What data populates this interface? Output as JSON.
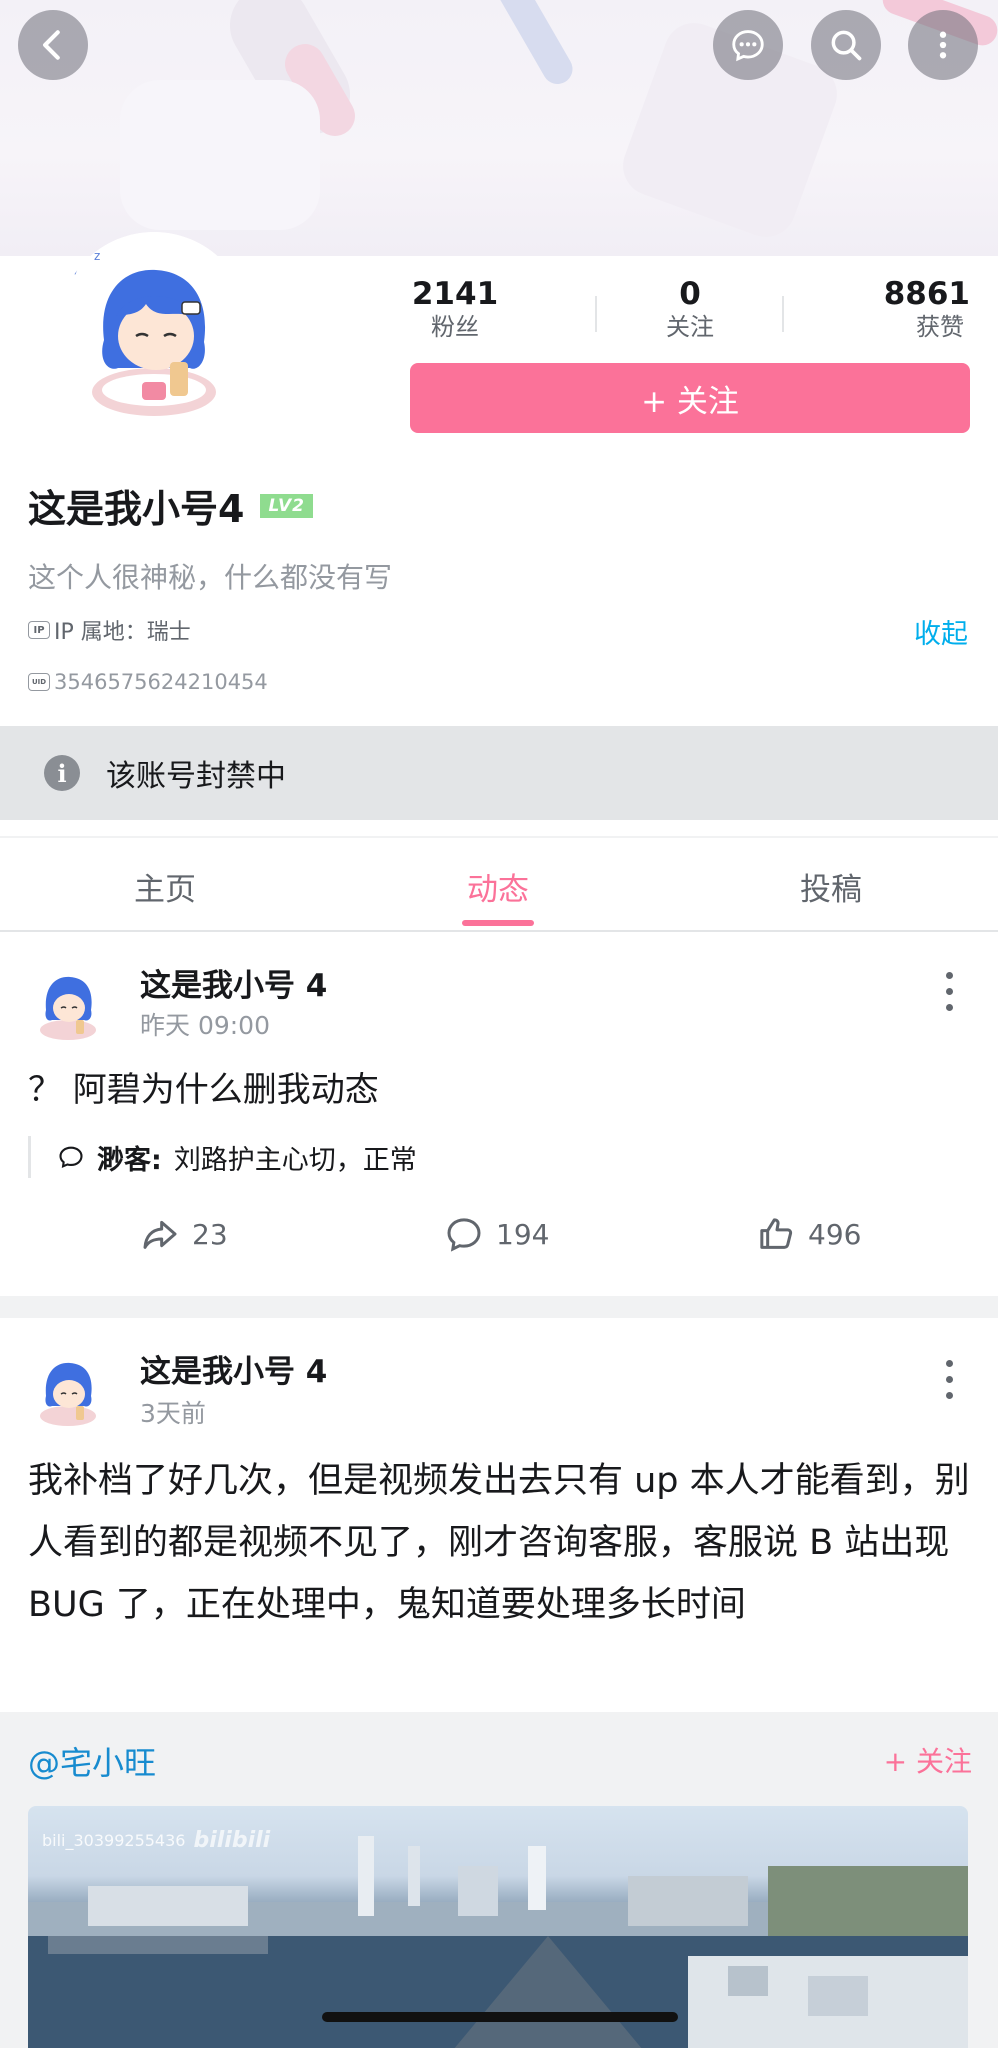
{
  "header": {
    "back_icon": "back-icon",
    "message_icon": "message-icon",
    "search_icon": "search-icon",
    "more_icon": "more-icon"
  },
  "profile": {
    "stats": [
      {
        "value": "2141",
        "label": "粉丝"
      },
      {
        "value": "0",
        "label": "关注"
      },
      {
        "value": "8861",
        "label": "获赞"
      }
    ],
    "follow_label": "+ 关注",
    "name": "这是我小号4",
    "level": "LV2",
    "bio": "这个人很神秘，什么都没有写",
    "ip_badge": "IP",
    "ip_text": "IP 属地：瑞士",
    "collapse_label": "收起",
    "uid_badge": "UID",
    "uid": "3546575624210454",
    "banned_notice": "该账号封禁中"
  },
  "tabs": [
    {
      "label": "主页",
      "active": false
    },
    {
      "label": "动态",
      "active": true
    },
    {
      "label": "投稿",
      "active": false
    }
  ],
  "posts": [
    {
      "author": "这是我小号 4",
      "time": "昨天 09:00",
      "text": "？ 阿碧为什么删我动态",
      "quote_author": "渺客:",
      "quote_text": "刘路护主心切，正常",
      "shares": "23",
      "comments": "194",
      "likes": "496"
    },
    {
      "author": "这是我小号 4",
      "time": "3天前",
      "text": "我补档了好几次，但是视频发出去只有 up 本人才能看到，别人看到的都是视频不见了，刚才咨询客服，客服说 B 站出现 BUG 了，正在处理中，鬼知道要处理多长时间",
      "repost_user": "@宅小旺",
      "repost_follow": "+ 关注",
      "video_watermark": "bili_30399255436",
      "video_logo": "bilibili"
    }
  ],
  "colors": {
    "accent_pink": "#fb7299",
    "link_blue": "#00aeec",
    "level_green": "#8fdc8f"
  }
}
